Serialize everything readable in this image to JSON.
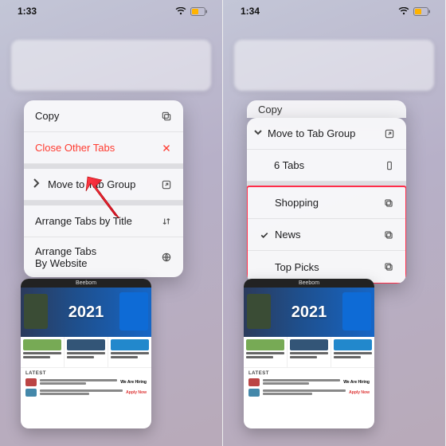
{
  "left": {
    "time": "1:33",
    "menu": {
      "copy": "Copy",
      "close_other": "Close Other Tabs",
      "move_group": "Move to Tab Group",
      "arrange_title": "Arrange Tabs by Title",
      "arrange_site": "Arrange Tabs\nBy Website"
    }
  },
  "right": {
    "time": "1:34",
    "menu": {
      "copy": "Copy",
      "move_group": "Move to Tab Group",
      "six_tabs": "6 Tabs",
      "shopping": "Shopping",
      "news": "News",
      "top_picks": "Top Picks"
    }
  },
  "thumb": {
    "site": "Beebom",
    "year": "2021",
    "latest_label": "LATEST",
    "hiring": "We Are Hiring",
    "apply": "Apply Now"
  }
}
